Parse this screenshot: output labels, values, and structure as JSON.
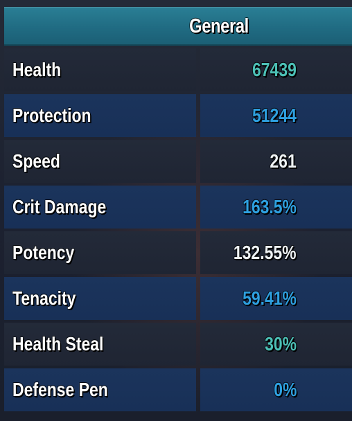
{
  "header": {
    "title": "General",
    "accent": "#206b82"
  },
  "stats": [
    {
      "label": "Health",
      "value": "67439",
      "value_color": "teal"
    },
    {
      "label": "Protection",
      "value": "51244",
      "value_color": "blue"
    },
    {
      "label": "Speed",
      "value": "261",
      "value_color": "white"
    },
    {
      "label": "Crit Damage",
      "value": "163.5%",
      "value_color": "blue"
    },
    {
      "label": "Potency",
      "value": "132.55%",
      "value_color": "white"
    },
    {
      "label": "Tenacity",
      "value": "59.41%",
      "value_color": "blue"
    },
    {
      "label": "Health Steal",
      "value": "30%",
      "value_color": "teal"
    },
    {
      "label": "Defense Pen",
      "value": "0%",
      "value_color": "blue"
    }
  ],
  "colors": {
    "teal": "#4cc0b6",
    "blue": "#2ea0e0",
    "white": "#eef2f4"
  }
}
